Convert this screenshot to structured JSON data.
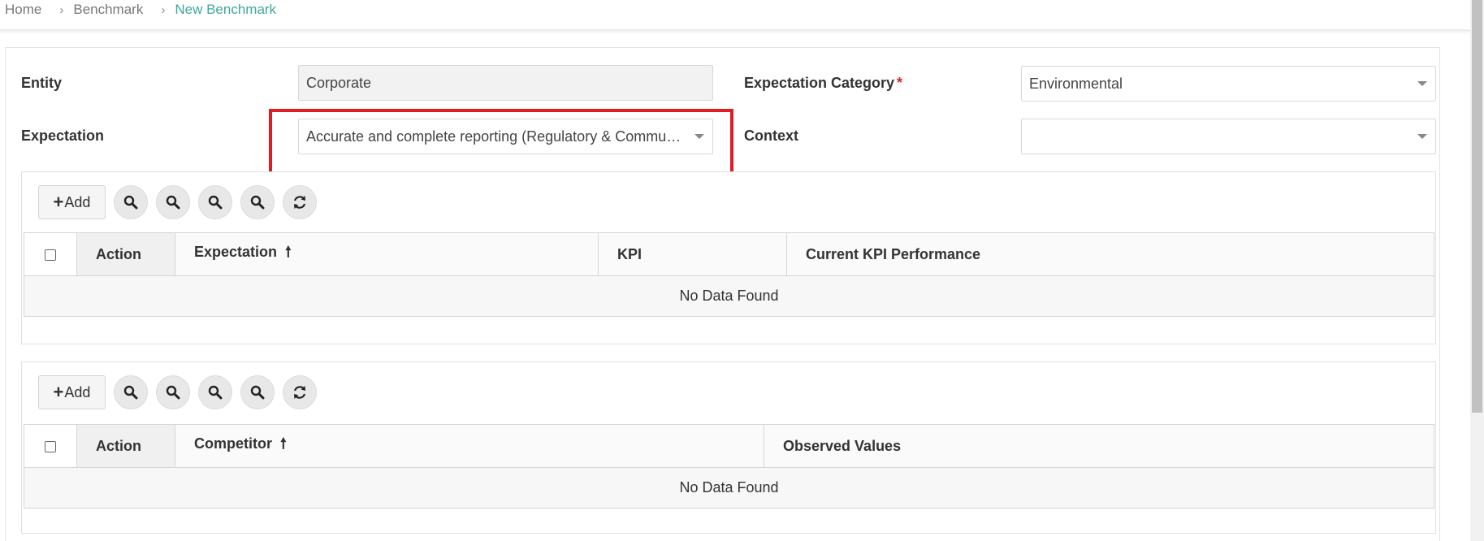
{
  "breadcrumb": {
    "home": "Home",
    "benchmark": "Benchmark",
    "current": "New Benchmark",
    "separator": "›"
  },
  "form": {
    "entity_label": "Entity",
    "entity_value": "Corporate",
    "expectation_category_label": "Expectation Category",
    "required_mark": "*",
    "expectation_category_value": "Environmental",
    "expectation_label": "Expectation",
    "expectation_value": "Accurate and complete reporting (Regulatory & Community)",
    "context_label": "Context",
    "context_value": ""
  },
  "grid1": {
    "add_label": "Add",
    "columns": {
      "action": "Action",
      "expectation": "Expectation",
      "kpi": "KPI",
      "current_kpi": "Current KPI Performance"
    },
    "sort_arrow": "🠕",
    "empty_text": "No Data Found"
  },
  "grid2": {
    "add_label": "Add",
    "columns": {
      "action": "Action",
      "competitor": "Competitor",
      "observed": "Observed Values"
    },
    "sort_arrow": "🠕",
    "empty_text": "No Data Found"
  },
  "colors": {
    "accent": "#3ea89a",
    "highlight": "#e11b22",
    "required": "#e02020"
  },
  "icons": [
    "plus-icon",
    "search-icon",
    "refresh-icon",
    "caret-down-icon",
    "sort-up-icon",
    "chevron-right-icon"
  ]
}
